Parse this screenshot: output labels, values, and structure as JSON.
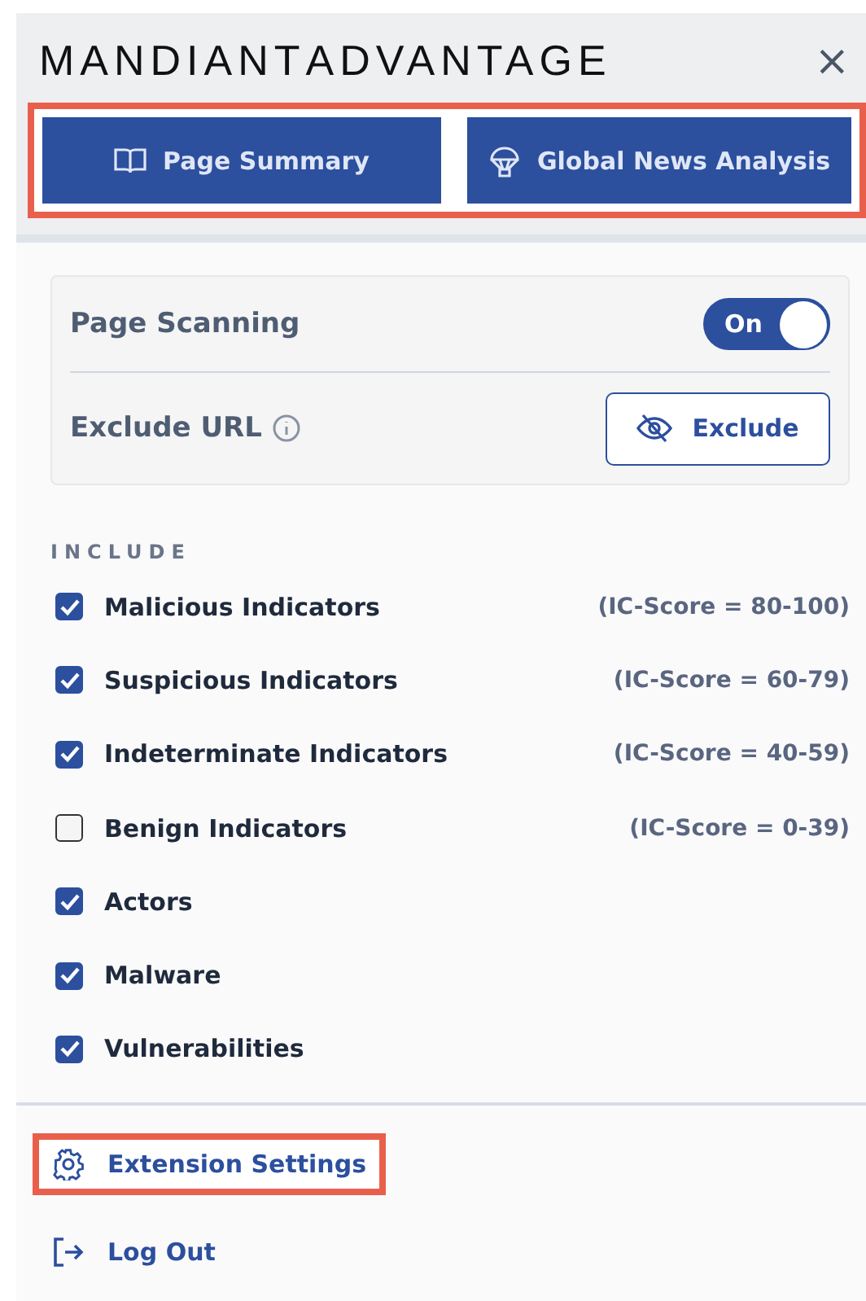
{
  "header": {
    "logo": "**MANDIANT**ADVANTAGE",
    "close": "×"
  },
  "tab_bar": {
    "highlighted": true,
    "tabs": [
      {
        "label": "Page Summary",
        "kind": "book"
      },
      {
        "label": "Global News Analysis",
        "kind": "balloon"
      }
    ]
  },
  "scanning": {
    "label": "Page Scanning",
    "toggle_text": "On",
    "on": true
  },
  "exclude": {
    "label": "Exclude URL",
    "button": "Exclude"
  },
  "include": {
    "heading": "INCLUDE",
    "items": [
      {
        "label": "Malicious Indicators",
        "checked": true,
        "score": "(IC-Score = 80-100)"
      },
      {
        "label": "Suspicious Indicators",
        "checked": true,
        "score": "(IC-Score = 60-79)"
      },
      {
        "label": "Indeterminate Indicators",
        "checked": true,
        "score": "(IC-Score = 40-59)"
      },
      {
        "label": "Benign Indicators",
        "checked": false,
        "score": "(IC-Score = 0-39)"
      },
      {
        "label": "Actors",
        "checked": true
      },
      {
        "label": "Malware",
        "checked": true
      },
      {
        "label": "Vulnerabilities",
        "checked": true
      }
    ]
  },
  "footer": [
    {
      "label": "Extension Settings",
      "kind": "settings",
      "highlighted": true
    },
    {
      "label": "Log Out",
      "kind": "logout",
      "highlighted": false
    }
  ]
}
